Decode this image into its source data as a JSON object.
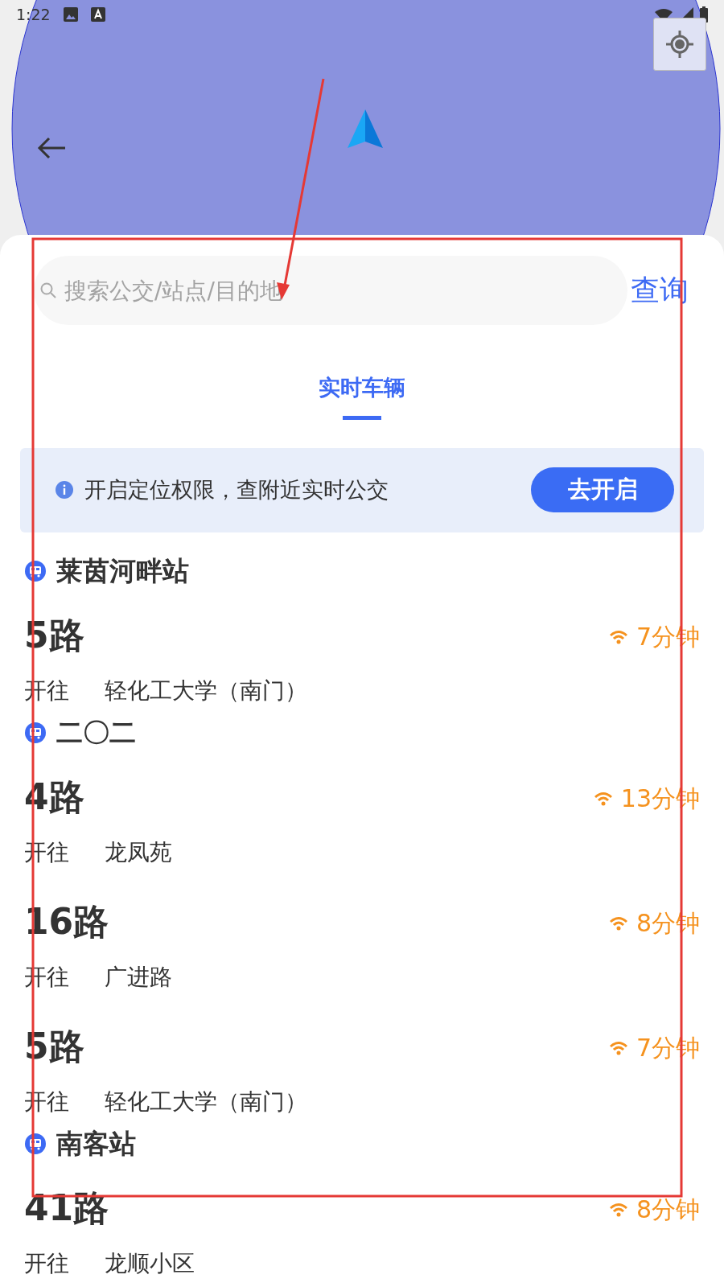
{
  "status_bar": {
    "time": "1:22"
  },
  "search": {
    "placeholder": "搜索公交/站点/目的地",
    "button": "查询"
  },
  "tabs": [
    {
      "label": "实时车辆",
      "selected": true
    }
  ],
  "banner": {
    "text": "开启定位权限，查附近实时公交",
    "button": "去开启"
  },
  "stations": [
    {
      "name": "莱茵河畔站",
      "routes": [
        {
          "route": "5路",
          "eta": "7分钟",
          "direction": "开往",
          "destination": "轻化工大学（南门）"
        }
      ]
    },
    {
      "name": "二〇二",
      "routes": [
        {
          "route": "4路",
          "eta": "13分钟",
          "direction": "开往",
          "destination": "龙凤苑"
        },
        {
          "route": "16路",
          "eta": "8分钟",
          "direction": "开往",
          "destination": "广进路"
        },
        {
          "route": "5路",
          "eta": "7分钟",
          "direction": "开往",
          "destination": "轻化工大学（南门）"
        }
      ]
    },
    {
      "name": "南客站",
      "routes": [
        {
          "route": "41路",
          "eta": "8分钟",
          "direction": "开往",
          "destination": "龙顺小区"
        }
      ]
    }
  ]
}
